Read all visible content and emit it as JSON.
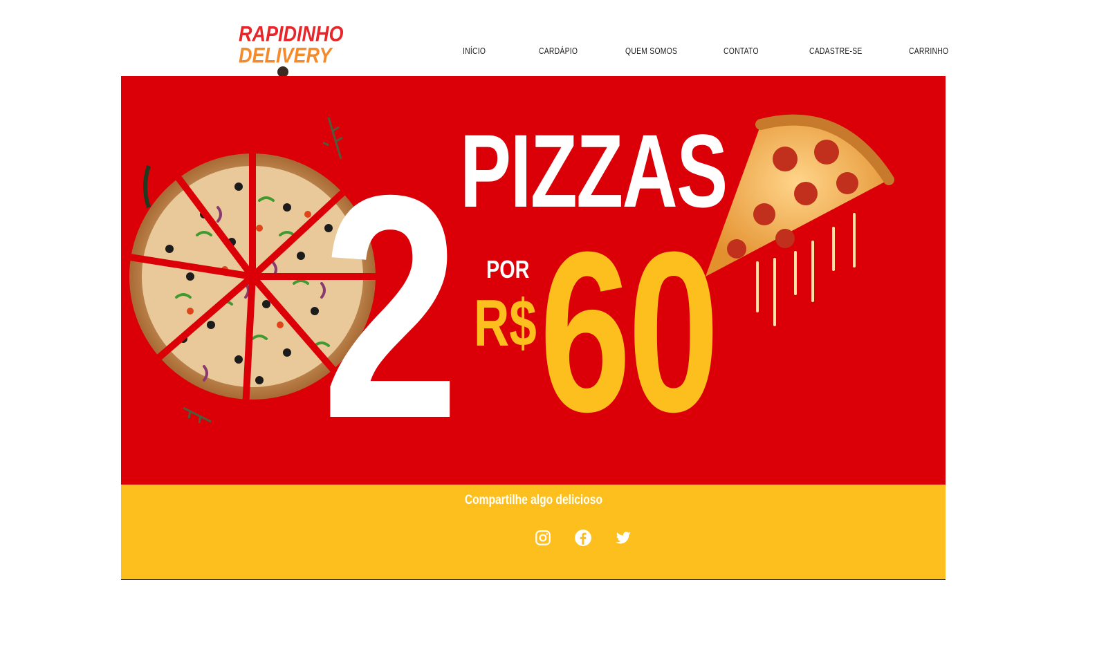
{
  "brand": {
    "line1": "RAPIDINHO",
    "line2": "DELIVERY",
    "colors": {
      "line1": "#e8262a",
      "line2": "#f58a2a"
    }
  },
  "nav": {
    "items": [
      {
        "label": "INÍCIO"
      },
      {
        "label": "CARDÁPIO"
      },
      {
        "label": "QUEM SOMOS"
      },
      {
        "label": "CONTATO"
      },
      {
        "label": "CADASTRE-SE"
      },
      {
        "label": "CARRINHO"
      }
    ]
  },
  "promo": {
    "quantity": "2",
    "product": "PIZZAS",
    "connector": "POR",
    "currency": "R$",
    "price": "60",
    "colors": {
      "background": "#db0007",
      "accent": "#fcbf1e",
      "text": "#ffffff"
    }
  },
  "footer": {
    "tagline": "Compartilhe algo delicioso",
    "social": [
      {
        "icon": "instagram-icon"
      },
      {
        "icon": "facebook-icon"
      },
      {
        "icon": "twitter-icon"
      }
    ],
    "colors": {
      "background": "#fcbf1e"
    }
  }
}
